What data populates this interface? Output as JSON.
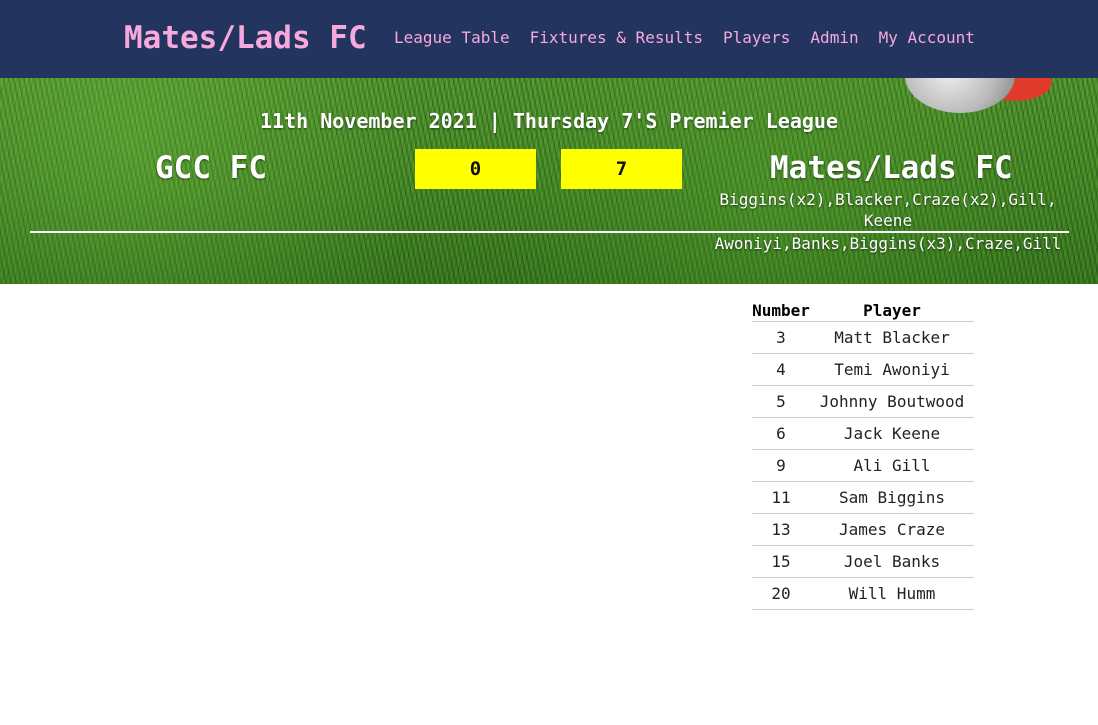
{
  "navbar": {
    "brand": "Mates/Lads FC",
    "links": [
      "League Table",
      "Fixtures & Results",
      "Players",
      "Admin",
      "My Account"
    ]
  },
  "match": {
    "header": "11th November 2021 | Thursday 7'S Premier League",
    "home_team": "GCC FC",
    "away_team": "Mates/Lads FC",
    "home_score": "0",
    "away_score": "7",
    "scorers_top": "Biggins(x2),Blacker,Craze(x2),Gill, Keene",
    "scorers_bottom": "Awoniyi,Banks,Biggins(x3),Craze,Gill"
  },
  "squad": {
    "headers": [
      "Number",
      "Player"
    ],
    "rows": [
      [
        "3",
        "Matt Blacker"
      ],
      [
        "4",
        "Temi Awoniyi"
      ],
      [
        "5",
        "Johnny Boutwood"
      ],
      [
        "6",
        "Jack Keene"
      ],
      [
        "9",
        "Ali Gill"
      ],
      [
        "11",
        "Sam Biggins"
      ],
      [
        "13",
        "James Craze"
      ],
      [
        "15",
        "Joel Banks"
      ],
      [
        "20",
        "Will Humm"
      ]
    ]
  },
  "colors": {
    "navbar_bg": "#23355f",
    "brand_pink": "#f7a8dc",
    "score_yellow": "#ffff00"
  }
}
